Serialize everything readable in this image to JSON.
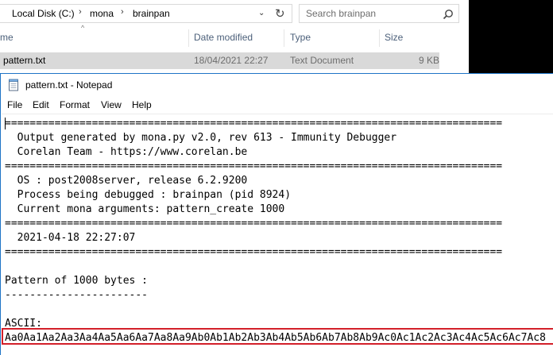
{
  "explorer": {
    "breadcrumbs": [
      "Local Disk (C:)",
      "mona",
      "brainpan"
    ],
    "search_placeholder": "Search brainpan",
    "columns": {
      "name": "me",
      "date": "Date modified",
      "type": "Type",
      "size": "Size"
    },
    "file": {
      "name": "pattern.txt",
      "date": "18/04/2021 22:27",
      "type": "Text Document",
      "size": "9 KB"
    }
  },
  "notepad": {
    "title": "pattern.txt - Notepad",
    "menu": [
      "File",
      "Edit",
      "Format",
      "View",
      "Help"
    ],
    "lines": [
      "================================================================================",
      "  Output generated by mona.py v2.0, rev 613 - Immunity Debugger",
      "  Corelan Team - https://www.corelan.be",
      "================================================================================",
      "  OS : post2008server, release 6.2.9200",
      "  Process being debugged : brainpan (pid 8924)",
      "  Current mona arguments: pattern_create 1000",
      "================================================================================",
      "  2021-04-18 22:27:07",
      "================================================================================",
      "",
      "Pattern of 1000 bytes :",
      "-----------------------",
      "",
      "ASCII:",
      "Aa0Aa1Aa2Aa3Aa4Aa5Aa6Aa7Aa8Aa9Ab0Ab1Ab2Ab3Ab4Ab5Ab6Ab7Ab8Ab9Ac0Ac1Ac2Ac3Ac4Ac5Ac6Ac7Ac8"
    ]
  },
  "colors": {
    "highlight_box": "#d3202a",
    "selection": "#d9d9d9",
    "window_border": "#1e74c6"
  }
}
